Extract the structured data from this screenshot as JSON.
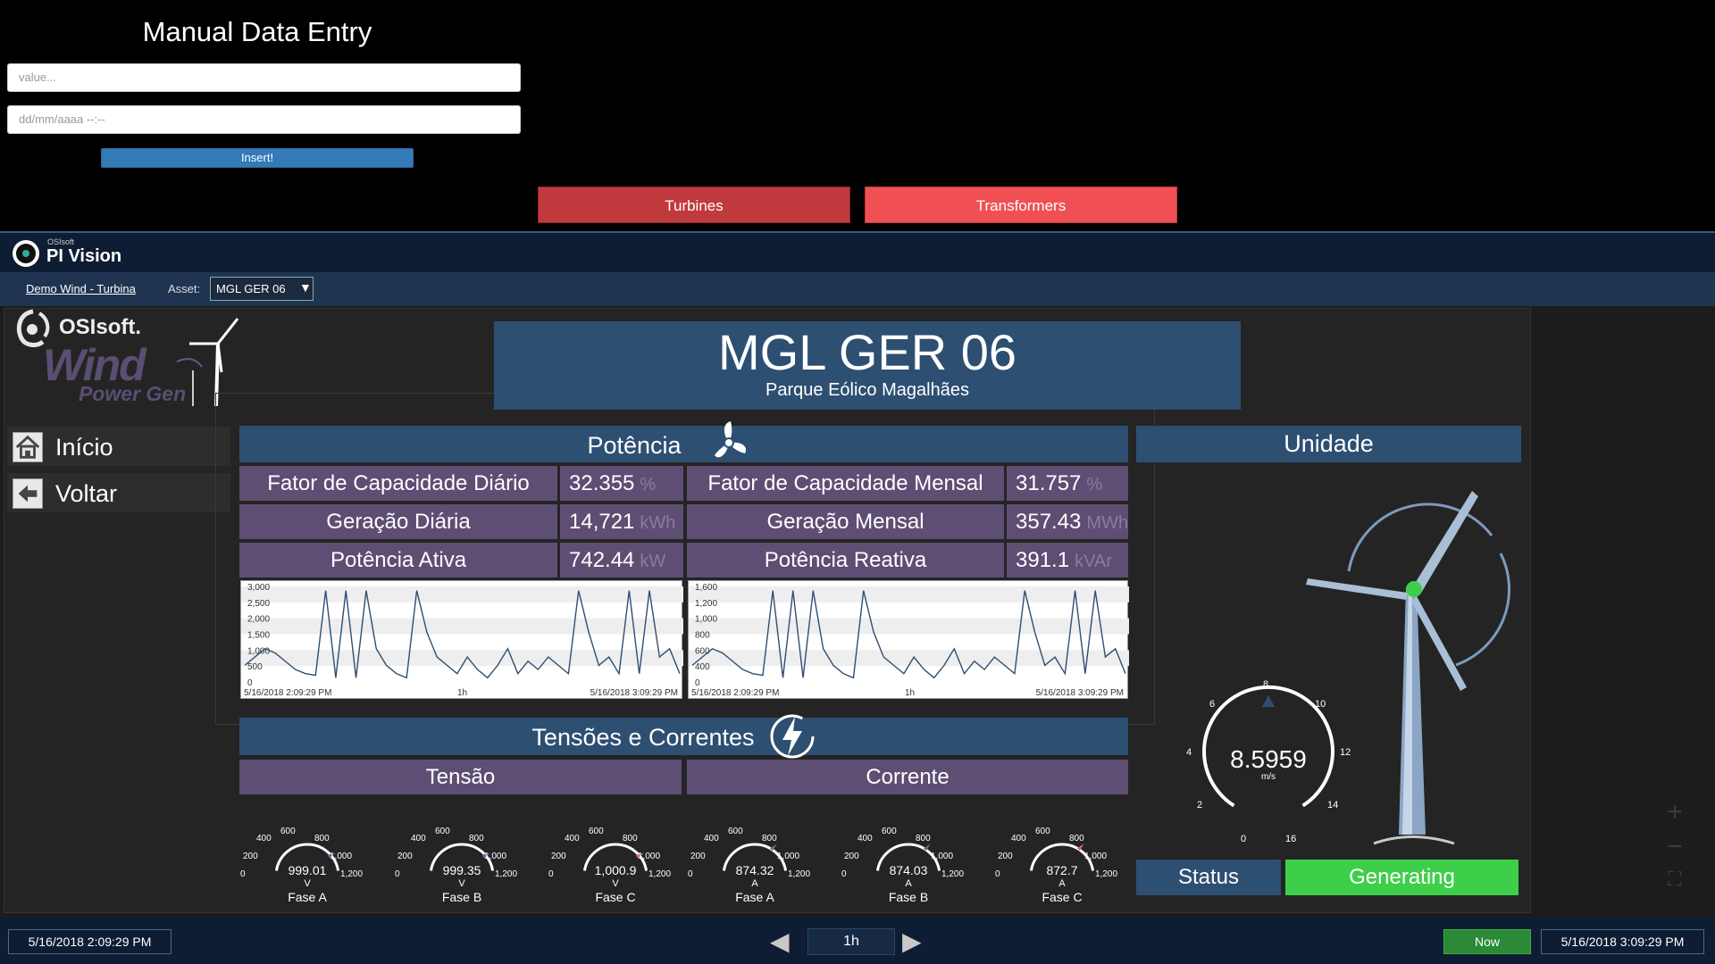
{
  "manual_entry": {
    "title": "Manual Data Entry",
    "value_placeholder": "value...",
    "date_placeholder": "dd/mm/aaaa --:--",
    "insert_label": "Insert!"
  },
  "nav_buttons": {
    "turbines": "Turbines",
    "transformers": "Transformers"
  },
  "pi_vision": {
    "vendor": "OSIsoft",
    "app_name": "PI Vision",
    "breadcrumb": "Demo Wind - Turbina",
    "asset_label": "Asset:",
    "asset_value": "MGL GER 06"
  },
  "brand": {
    "osisoft": "OSIsoft.",
    "wind": "Wind",
    "power_gen": "Power Gen"
  },
  "side_nav": [
    {
      "label": "Início",
      "icon": "home-icon"
    },
    {
      "label": "Voltar",
      "icon": "arrow-left-icon"
    }
  ],
  "display": {
    "title": "MGL GER 06",
    "subtitle": "Parque Eólico Magalhães",
    "potencia_header": "Potência",
    "unidade_header": "Unidade",
    "kpis": [
      {
        "label": "Fator de Capacidade Diário",
        "value": "32.355",
        "unit": "%"
      },
      {
        "label": "Fator de Capacidade Mensal",
        "value": "31.757",
        "unit": "%"
      },
      {
        "label": "Geração Diária",
        "value": "14,721",
        "unit": "kWh"
      },
      {
        "label": "Geração Mensal",
        "value": "357.43",
        "unit": "MWh"
      },
      {
        "label": "Potência Ativa",
        "value": "742.44",
        "unit": "kW"
      },
      {
        "label": "Potência Reativa",
        "value": "391.1",
        "unit": "kVAr"
      }
    ],
    "tensoes_header": "Tensões e Correntes",
    "tensao_header": "Tensão",
    "corrente_header": "Corrente",
    "status_label": "Status",
    "status_value": "Generating",
    "status_color": "#3ecf4a"
  },
  "trends": [
    {
      "ticks": [
        "3,000",
        "2,500",
        "2,000",
        "1,500",
        "1,000",
        "500",
        "0"
      ],
      "start": "5/16/2018 2:09:29 PM",
      "mid": "1h",
      "end": "5/16/2018 3:09:29 PM"
    },
    {
      "ticks": [
        "1,600",
        "1,200",
        "1,000",
        "800",
        "600",
        "400",
        "0"
      ],
      "start": "5/16/2018 2:09:29 PM",
      "mid": "1h",
      "end": "5/16/2018 3:09:29 PM"
    }
  ],
  "gauges": [
    {
      "value": "999.01",
      "unit": "V",
      "name": "Fase A",
      "level": 0.8325
    },
    {
      "value": "999.35",
      "unit": "V",
      "name": "Fase B",
      "level": 0.833
    },
    {
      "value": "1,000.9",
      "unit": "V",
      "name": "Fase C",
      "level": 0.834
    },
    {
      "value": "874.32",
      "unit": "A",
      "name": "Fase A",
      "level": 0.729
    },
    {
      "value": "874.03",
      "unit": "A",
      "name": "Fase B",
      "level": 0.728
    },
    {
      "value": "872.7",
      "unit": "A",
      "name": "Fase C",
      "level": 0.727
    }
  ],
  "gauge_ticks": [
    "0",
    "200",
    "400",
    "600",
    "800",
    "1,000",
    "1,200"
  ],
  "wind_speed": {
    "value": "8.5959",
    "unit": "m/s",
    "ticks": [
      "0",
      "2",
      "4",
      "6",
      "8",
      "10",
      "12",
      "14",
      "16"
    ]
  },
  "timebar": {
    "start": "5/16/2018 2:09:29 PM",
    "duration": "1h",
    "now": "Now",
    "end": "5/16/2018 3:09:29 PM"
  }
}
